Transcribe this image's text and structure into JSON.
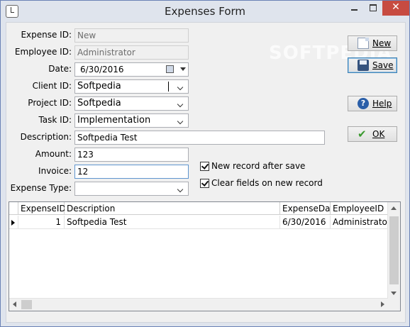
{
  "window": {
    "title": "Expenses Form"
  },
  "watermark": "SOFTPEDIA",
  "form": {
    "expense_id": {
      "label": "Expense ID:",
      "value": "New"
    },
    "employee_id": {
      "label": "Employee ID:",
      "value": "Administrator"
    },
    "date": {
      "label": "Date:",
      "value": "6/30/2016"
    },
    "client_id": {
      "label": "Client ID:",
      "value": "Softpedia"
    },
    "project_id": {
      "label": "Project ID:",
      "value": "Softpedia"
    },
    "task_id": {
      "label": "Task ID:",
      "value": "Implementation"
    },
    "description": {
      "label": "Description:",
      "value": "Softpedia Test"
    },
    "amount": {
      "label": "Amount:",
      "value": "123"
    },
    "invoice": {
      "label": "Invoice:",
      "value": "12"
    },
    "expense_type": {
      "label": "Expense Type:",
      "value": ""
    }
  },
  "options": {
    "new_record_after_save": {
      "label": "New record after save",
      "checked": true
    },
    "clear_fields": {
      "label": "Clear fields on new record",
      "checked": true
    }
  },
  "buttons": {
    "new": "New",
    "save": "Save",
    "help": "Help",
    "ok": "OK"
  },
  "grid": {
    "columns": [
      "ExpenseID",
      "Description",
      "ExpenseDate",
      "EmployeeID"
    ],
    "rows": [
      {
        "expense_id": "1",
        "description": "Softpedia Test",
        "expense_date": "6/30/2016",
        "employee_id": "Administrator"
      }
    ]
  }
}
